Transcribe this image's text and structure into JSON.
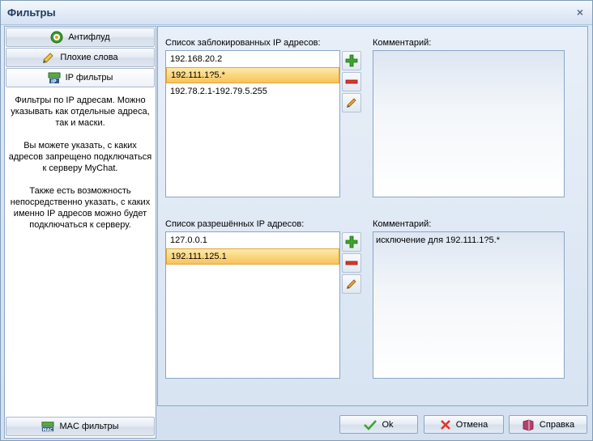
{
  "window": {
    "title": "Фильтры",
    "close_glyph": "×"
  },
  "sidebar": {
    "items": [
      {
        "label": "Антифлуд",
        "icon": "antiflood-icon"
      },
      {
        "label": "Плохие слова",
        "icon": "bad-words-icon"
      },
      {
        "label": "IP фильтры",
        "icon": "ip-filter-icon"
      }
    ],
    "description": [
      "Фильтры по IP адресам. Можно указывать как отдельные адреса, так и маски.",
      "Вы можете указать, с каких адресов запрещено подключаться к серверу MyChat.",
      "Также есть возможность непосредственно указать, с каких именно IP адресов можно будет подключаться к серверу."
    ],
    "bottom_item": {
      "label": "MAC фильтры",
      "icon": "mac-filter-icon"
    }
  },
  "blocked": {
    "label": "Список заблокированных IP адресов:",
    "items": [
      "192.168.20.2",
      "192.111.1?5.*",
      "192.78.2.1-192.79.5.255"
    ],
    "selected_index": 1,
    "comment_label": "Комментарий:",
    "comment_value": ""
  },
  "allowed": {
    "label": "Список разрешённых IP адресов:",
    "items": [
      "127.0.0.1",
      "192.111.125.1"
    ],
    "selected_index": 1,
    "comment_label": "Комментарий:",
    "comment_value": "исключение для 192.111.1?5.*"
  },
  "buttons": {
    "ok": "Ok",
    "cancel": "Отмена",
    "help": "Справка"
  },
  "colors": {
    "accent": "#1e395b",
    "selection": "#f8c35b",
    "add": "#3aa52b",
    "remove": "#e0352a"
  }
}
